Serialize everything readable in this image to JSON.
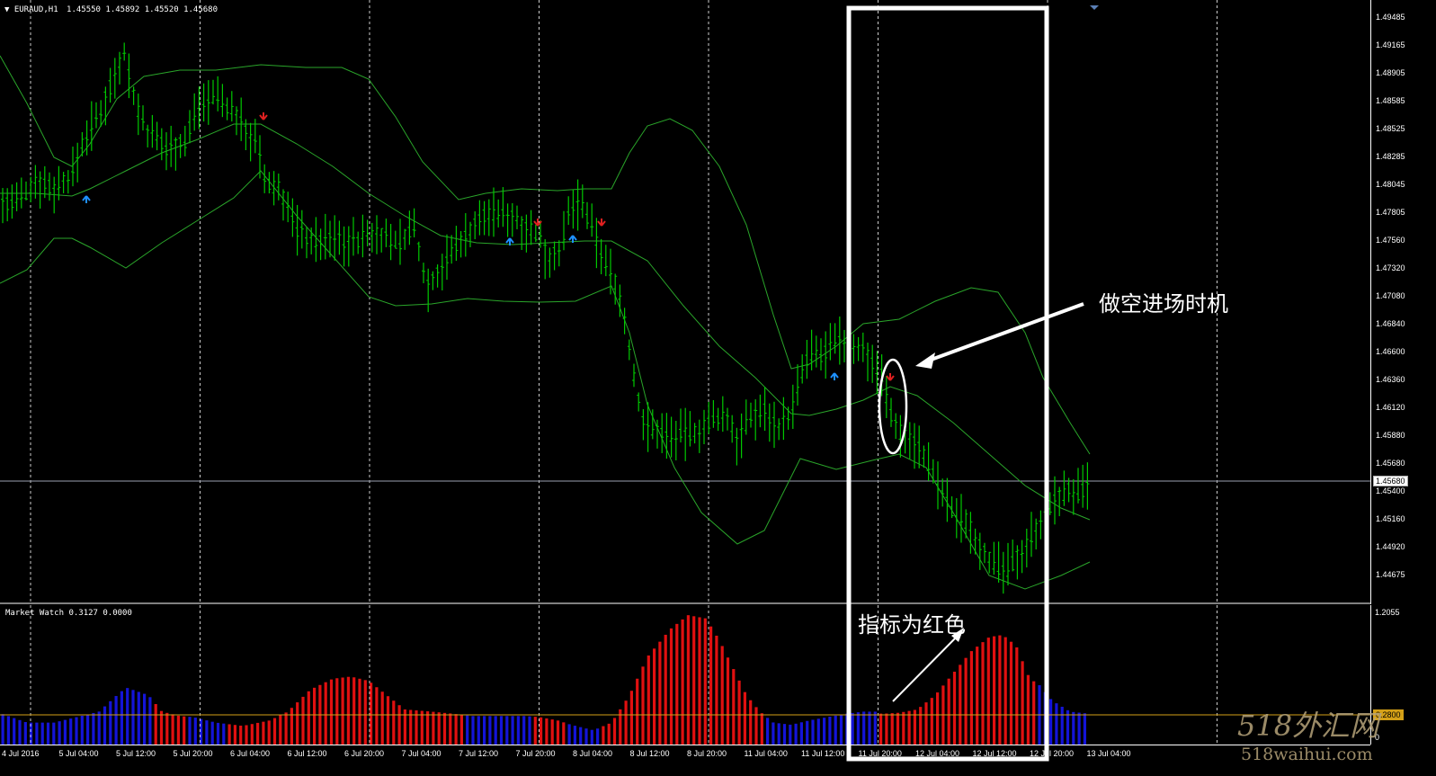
{
  "header": {
    "symbol": "EURAUD,H1",
    "ohlc": "1.45550 1.45892 1.45520 1.45680"
  },
  "indicator_header": "Market Watch 0.3127 0.0000",
  "price_axis": [
    "1.49485",
    "1.49165",
    "1.48905",
    "1.48585",
    "1.48525",
    "1.48285",
    "1.48045",
    "1.47805",
    "1.47560",
    "1.47320",
    "1.47080",
    "1.46840",
    "1.46600",
    "1.46360",
    "1.46120",
    "1.45880",
    "1.45680",
    "1.45400",
    "1.45160",
    "1.44920",
    "1.44675"
  ],
  "current_price": "1.45680",
  "indicator_axis": {
    "top": "1.2055",
    "level": "0.2800",
    "bottom": "0"
  },
  "time_axis": [
    "4 Jul 2016",
    "5 Jul 04:00",
    "5 Jul 12:00",
    "5 Jul 20:00",
    "6 Jul 04:00",
    "6 Jul 12:00",
    "6 Jul 20:00",
    "7 Jul 04:00",
    "7 Jul 12:00",
    "7 Jul 20:00",
    "8 Jul 04:00",
    "8 Jul 12:00",
    "8 Jul 20:00",
    "11 Jul 04:00",
    "11 Jul 12:00",
    "11 Jul 20:00",
    "12 Jul 04:00",
    "12 Jul 12:00",
    "12 Jul 20:00",
    "13 Jul 04:00"
  ],
  "annotations": {
    "entry": "做空进场时机",
    "indicator": "指标为红色"
  },
  "watermark": {
    "logo": "518外汇网",
    "url": "518waihui.com"
  },
  "colors": {
    "candle": "#00c800",
    "band": "#2aa52a",
    "up_arrow": "#1e90ff",
    "down_arrow": "#e02020",
    "hist_red": "#e01010",
    "hist_blue": "#1414d8",
    "level": "#d4a017"
  },
  "chart_data": {
    "type": "bar",
    "description_series": [
      {
        "name": "EURAUD,H1"
      }
    ],
    "ylim": [
      1.44675,
      1.49485
    ],
    "indicator_ylim": [
      0,
      1.2055
    ]
  }
}
